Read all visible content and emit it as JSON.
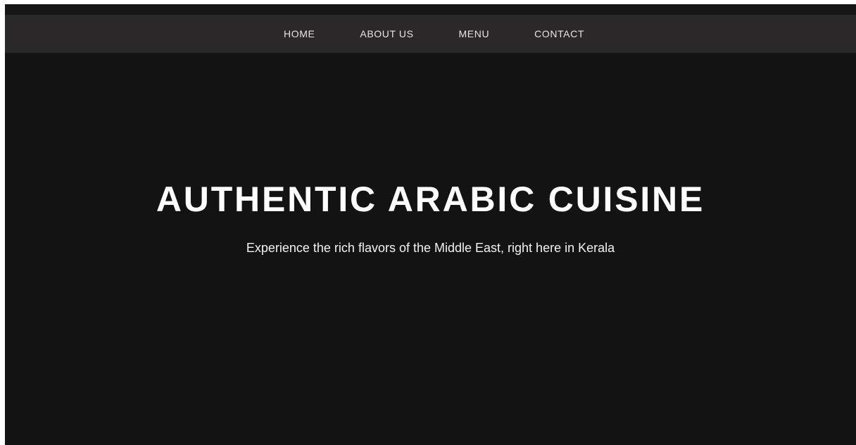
{
  "nav": {
    "items": [
      {
        "label": "HOME"
      },
      {
        "label": "ABOUT US"
      },
      {
        "label": "MENU"
      },
      {
        "label": "CONTACT"
      }
    ]
  },
  "hero": {
    "title": "AUTHENTIC ARABIC CUISINE",
    "subtitle": "Experience the rich flavors of the Middle East, right here in Kerala"
  },
  "colors": {
    "background": "#131313",
    "navbar": "#2a2829",
    "text": "#ffffff"
  }
}
